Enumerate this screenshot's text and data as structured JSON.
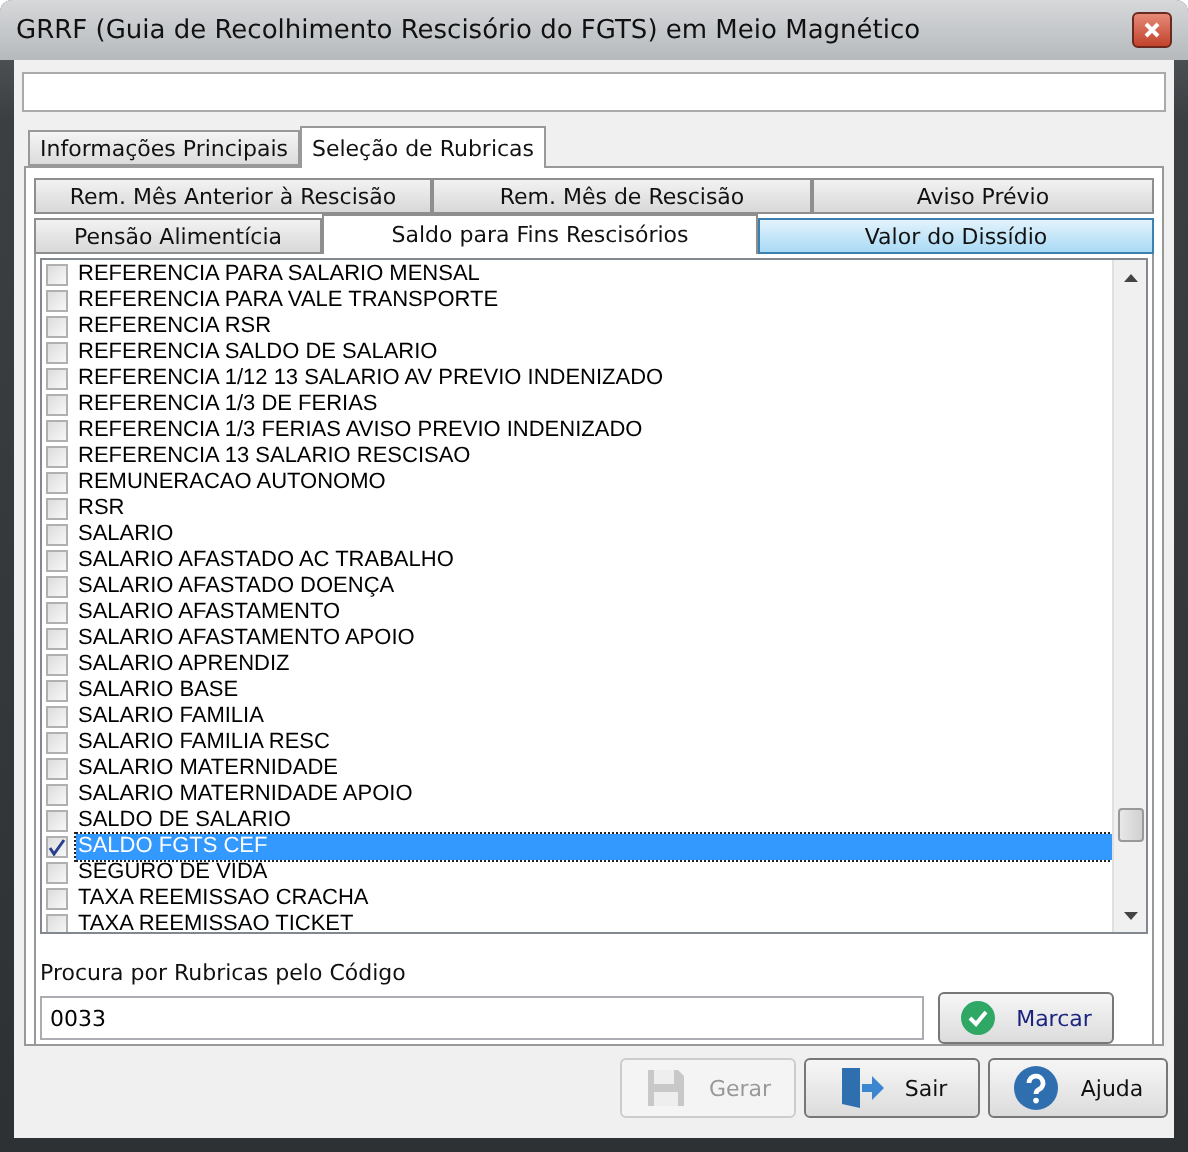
{
  "window": {
    "title": "GRRF (Guia de Recolhimento Rescisório do FGTS) em Meio Magnético"
  },
  "tabs": [
    {
      "label": "Informações Principais",
      "selected": false
    },
    {
      "label": "Seleção de Rubricas",
      "selected": true
    }
  ],
  "sub_tab_rows": [
    [
      {
        "label": "Rem. Mês Anterior à Rescisão",
        "selected": false,
        "hovered": false
      },
      {
        "label": "Rem. Mês de Rescisão",
        "selected": false,
        "hovered": false
      },
      {
        "label": "Aviso Prévio",
        "selected": false,
        "hovered": false
      }
    ],
    [
      {
        "label": "Pensão Alimentícia",
        "selected": false,
        "hovered": false
      },
      {
        "label": "Saldo para Fins Rescisórios",
        "selected": true,
        "hovered": false
      },
      {
        "label": "Valor do Dissídio",
        "selected": false,
        "hovered": true
      }
    ]
  ],
  "rubricas": [
    {
      "label": "REFERENCIA PARA SALARIO MENSAL",
      "checked": false,
      "selected": false
    },
    {
      "label": "REFERENCIA PARA VALE TRANSPORTE",
      "checked": false,
      "selected": false
    },
    {
      "label": "REFERENCIA RSR",
      "checked": false,
      "selected": false
    },
    {
      "label": "REFERENCIA SALDO DE SALARIO",
      "checked": false,
      "selected": false
    },
    {
      "label": "REFERENCIA 1/12 13 SALARIO AV PREVIO INDENIZADO",
      "checked": false,
      "selected": false
    },
    {
      "label": "REFERENCIA 1/3 DE FERIAS",
      "checked": false,
      "selected": false
    },
    {
      "label": "REFERENCIA 1/3 FERIAS AVISO PREVIO INDENIZADO",
      "checked": false,
      "selected": false
    },
    {
      "label": "REFERENCIA 13 SALARIO RESCISAO",
      "checked": false,
      "selected": false
    },
    {
      "label": "REMUNERACAO AUTONOMO",
      "checked": false,
      "selected": false
    },
    {
      "label": "RSR",
      "checked": false,
      "selected": false
    },
    {
      "label": "SALARIO",
      "checked": false,
      "selected": false
    },
    {
      "label": "SALARIO AFASTADO AC TRABALHO",
      "checked": false,
      "selected": false
    },
    {
      "label": "SALARIO AFASTADO DOENÇA",
      "checked": false,
      "selected": false
    },
    {
      "label": "SALARIO AFASTAMENTO",
      "checked": false,
      "selected": false
    },
    {
      "label": "SALARIO AFASTAMENTO APOIO",
      "checked": false,
      "selected": false
    },
    {
      "label": "SALARIO APRENDIZ",
      "checked": false,
      "selected": false
    },
    {
      "label": "SALARIO BASE",
      "checked": false,
      "selected": false
    },
    {
      "label": "SALARIO FAMILIA",
      "checked": false,
      "selected": false
    },
    {
      "label": "SALARIO FAMILIA RESC",
      "checked": false,
      "selected": false
    },
    {
      "label": "SALARIO MATERNIDADE",
      "checked": false,
      "selected": false
    },
    {
      "label": "SALARIO MATERNIDADE APOIO",
      "checked": false,
      "selected": false
    },
    {
      "label": "SALDO DE SALARIO",
      "checked": false,
      "selected": false
    },
    {
      "label": "SALDO FGTS CEF",
      "checked": true,
      "selected": true
    },
    {
      "label": "SEGURO DE VIDA",
      "checked": false,
      "selected": false
    },
    {
      "label": "TAXA REEMISSAO CRACHA",
      "checked": false,
      "selected": false
    },
    {
      "label": "TAXA REEMISSAO TICKET",
      "checked": false,
      "selected": false
    }
  ],
  "search": {
    "label": "Procura por Rubricas pelo Código",
    "value": "0033",
    "button": "Marcar"
  },
  "buttons": [
    {
      "kind": "save",
      "label": "Gerar",
      "disabled": true
    },
    {
      "kind": "exit",
      "label": "Sair",
      "disabled": false
    },
    {
      "kind": "help",
      "label": "Ajuda",
      "disabled": false
    }
  ]
}
